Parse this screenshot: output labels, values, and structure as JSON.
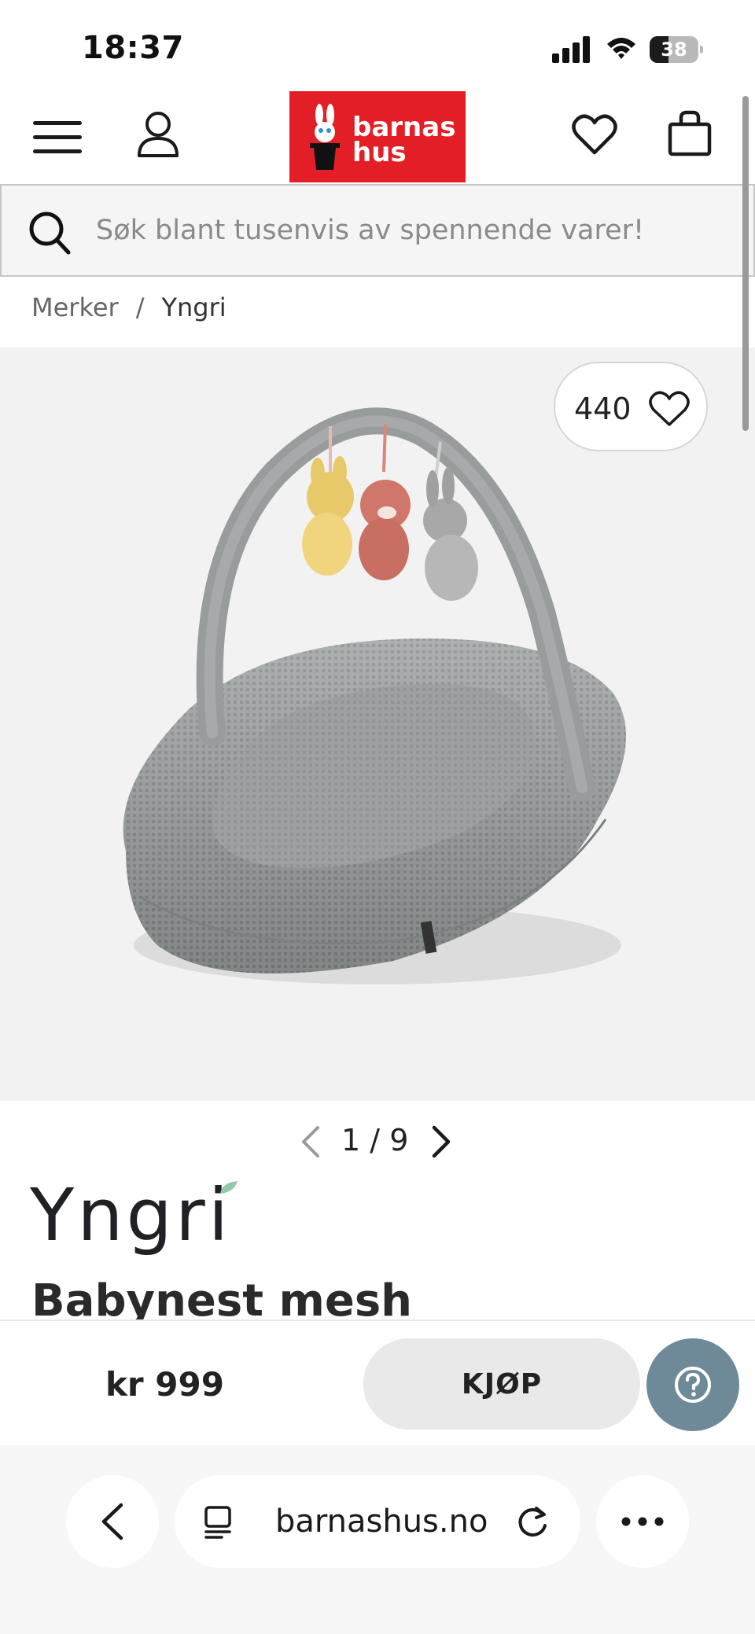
{
  "status_bar": {
    "time": "18:37",
    "battery_level": "38",
    "icons": [
      "cellular-signal-icon",
      "wifi-icon",
      "battery-icon"
    ]
  },
  "header": {
    "icons": [
      "menu-icon",
      "account-icon",
      "wishlist-heart-icon",
      "shopping-bag-icon"
    ],
    "logo": {
      "line1": "barnas",
      "line2": "hus",
      "background": "#e41e26"
    }
  },
  "search": {
    "placeholder": "Søk blant tusenvis av spennende varer!"
  },
  "breadcrumb": {
    "parent": "Merker",
    "separator": "/",
    "current": "Yngri"
  },
  "gallery": {
    "favorite_count": "440",
    "current_index": "1",
    "total": "9",
    "separator": "/"
  },
  "product": {
    "brand": "Yngri",
    "brand_logo_text": "Yngri",
    "title": "Babynest mesh",
    "price": "kr 999",
    "buy_label": "KJØP"
  },
  "colors": {
    "brand_red": "#e41e26",
    "help_button": "#6e8a99",
    "buy_button": "#e9e9e9"
  },
  "browser": {
    "url": "barnashus.no",
    "icons": [
      "back-icon",
      "reader-mode-icon",
      "reload-icon",
      "more-icon"
    ]
  }
}
